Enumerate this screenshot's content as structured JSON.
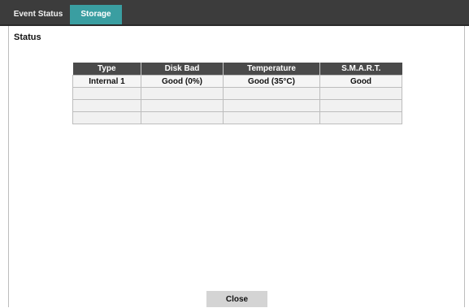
{
  "tabs": [
    {
      "label": "Event Status"
    },
    {
      "label": "Storage"
    }
  ],
  "section_title": "Status",
  "table": {
    "headers": [
      "Type",
      "Disk Bad",
      "Temperature",
      "S.M.A.R.T."
    ],
    "rows": [
      [
        "Internal 1",
        "Good (0%)",
        "Good (35°C)",
        "Good"
      ],
      [
        "",
        "",
        "",
        ""
      ],
      [
        "",
        "",
        "",
        ""
      ],
      [
        "",
        "",
        "",
        ""
      ]
    ]
  },
  "close_label": "Close",
  "colors": {
    "tab_active": "#3a9ea1",
    "tabbar": "#3c3c3c",
    "header": "#4a4a4a"
  }
}
